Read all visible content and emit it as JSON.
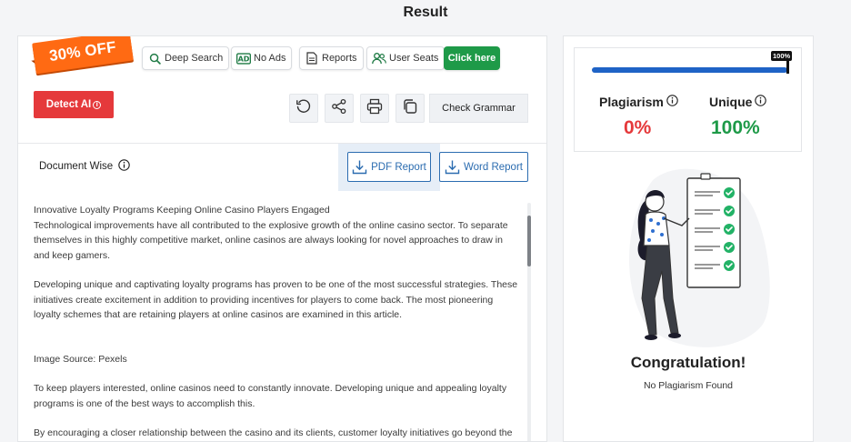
{
  "header": {
    "title": "Result"
  },
  "promo": {
    "label": "30% OFF"
  },
  "toolbar": {
    "deep_search": "Deep Search",
    "no_ads": "No Ads",
    "reports": "Reports",
    "user_seats": "User Seats",
    "click_here": "Click here"
  },
  "actions": {
    "detect_ai": "Detect AI",
    "check_grammar": "Check Grammar"
  },
  "document": {
    "label": "Document Wise",
    "pdf_report": "PDF Report",
    "word_report": "Word Report",
    "paragraphs": [
      "Innovative Loyalty Programs Keeping Online Casino Players Engaged",
      "Technological improvements have all contributed to the explosive growth of the online casino sector. To separate themselves in this highly competitive market, online casinos are always looking for novel approaches to draw in and keep gamers.",
      "Developing unique and captivating loyalty programs has proven to be one of the most successful strategies. These initiatives create excitement in addition to providing incentives for players to come back. The most pioneering loyalty schemes that are retaining players at online casinos are examined in this article.",
      "Image Source: Pexels",
      "To keep players interested, online casinos need to constantly innovate. Developing unique and appealing loyalty programs is one of the best ways to accomplish this.",
      "By encouraging a closer relationship between the casino and its clients, customer loyalty initiatives go beyond the"
    ]
  },
  "results": {
    "progress_label": "100%",
    "progress_fraction": 1.0,
    "plagiarism_label": "Plagiarism",
    "plagiarism_value": "0%",
    "unique_label": "Unique",
    "unique_value": "100%",
    "congrats": "Congratulation!",
    "no_plagiarism": "No Plagiarism Found"
  },
  "colors": {
    "accent_blue": "#1f63c6",
    "green": "#1e9a48",
    "red": "#e5393b",
    "promo_orange": "#ff6a13"
  }
}
